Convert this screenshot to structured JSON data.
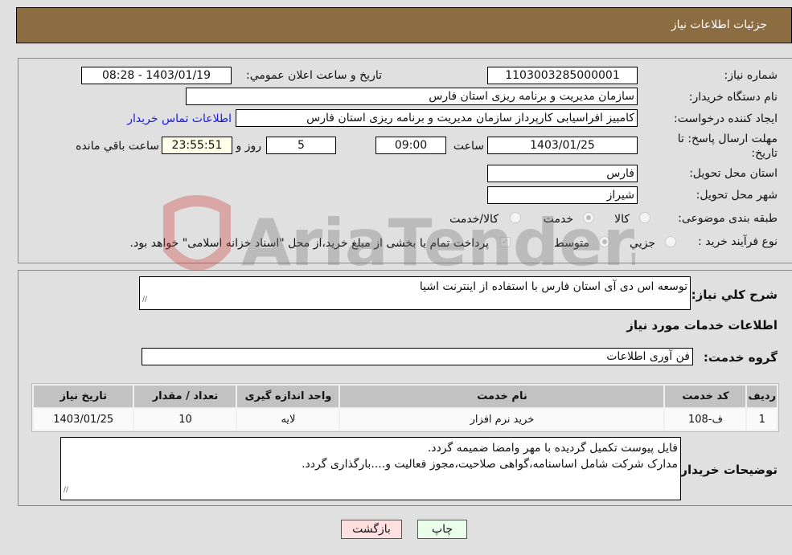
{
  "header": {
    "title": "جزئیات اطلاعات نیاز"
  },
  "form": {
    "need_number_label": "شماره نیاز:",
    "need_number": "1103003285000001",
    "announce_label": "تاریخ و ساعت اعلان عمومي:",
    "announce_value": "1403/01/19 - 08:28",
    "buyer_label": "نام دستگاه خریدار:",
    "buyer_value": "سازمان مدیریت و برنامه ریزی استان فارس",
    "creator_label": "ایجاد کننده درخواست:",
    "creator_value": "کامبیز افراسیابی کارپرداز سازمان مدیریت و برنامه ریزی استان فارس",
    "contact_link": "اطلاعات تماس خریدار",
    "deadline_label_1": "مهلت ارسال پاسخ: تا",
    "deadline_label_2": "تاریخ:",
    "deadline_date": "1403/01/25",
    "time_label": "ساعت",
    "deadline_time": "09:00",
    "days_value": "5",
    "days_label": "روز و",
    "remaining_time": "23:55:51",
    "remaining_label": "ساعت باقي مانده",
    "province_label": "استان محل تحویل:",
    "province_value": "فارس",
    "city_label": "شهر محل تحویل:",
    "city_value": "شیراز",
    "category_label": "طبقه بندی موضوعی:",
    "category_options": [
      "کالا",
      "خدمت",
      "کالا/خدمت"
    ],
    "category_selected": "خدمت",
    "process_label": "نوع فرآیند خرید :",
    "process_options": [
      "جزيي",
      "متوسط"
    ],
    "process_selected": "متوسط",
    "treasury_note": "پرداخت تمام یا بخشی از مبلغ خرید،از محل \"اسناد خزانه اسلامی\" خواهد بود.",
    "treasury_checked": true
  },
  "details": {
    "description_label": "شرح كلي نياز:",
    "description_value": "توسعه اس دی آی استان فارس با استفاده از اینترنت اشیا",
    "services_heading": "اطلاعات خدمات مورد نیاز",
    "service_group_label": "گروه خدمت:",
    "service_group_value": "فن آوری اطلاعات",
    "table": {
      "headers": [
        "ردیف",
        "کد خدمت",
        "نام خدمت",
        "واحد اندازه گیری",
        "تعداد / مقدار",
        "تاریخ نیاز"
      ],
      "rows": [
        [
          "1",
          "ف-108",
          "خرید نرم افزار",
          "لایه",
          "10",
          "1403/01/25"
        ]
      ]
    },
    "buyer_notes_label": "توضیحات خریدار:",
    "buyer_notes_line1": "فایل پیوست تکمیل گردیده با مهر وامضا ضمیمه گردد.",
    "buyer_notes_line2": "مدارک شرکت شامل اساسنامه،گواهی صلاحیت،مجوز فعالیت و....بارگذاری گردد."
  },
  "buttons": {
    "print": "چاپ",
    "back": "بازگشت"
  },
  "watermark": "AriaTender.neT"
}
